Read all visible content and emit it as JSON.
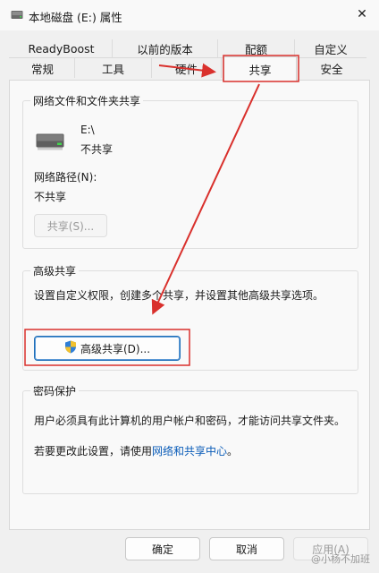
{
  "window": {
    "title": "本地磁盘 (E:) 属性",
    "close_glyph": "✕"
  },
  "tabs": {
    "row1": [
      "ReadyBoost",
      "以前的版本",
      "配额",
      "自定义"
    ],
    "row2": [
      "常规",
      "工具",
      "硬件",
      "共享",
      "安全"
    ],
    "active": "共享"
  },
  "network_sharing": {
    "group_title": "网络文件和文件夹共享",
    "drive_name": "E:\\",
    "drive_status": "不共享",
    "path_label": "网络路径(N):",
    "path_value": "不共享",
    "share_button": "共享(S)..."
  },
  "advanced_sharing": {
    "group_title": "高级共享",
    "description": "设置自定义权限，创建多个共享，并设置其他高级共享选项。",
    "button": "高级共享(D)..."
  },
  "password_protection": {
    "group_title": "密码保护",
    "description": "用户必须具有此计算机的用户帐户和密码，才能访问共享文件夹。",
    "change_prefix": "若要更改此设置，请使用",
    "change_link": "网络和共享中心",
    "change_suffix": "。"
  },
  "footer": {
    "ok": "确定",
    "cancel": "取消",
    "apply": "应用(A)"
  },
  "watermark": "@小杨不加班",
  "colors": {
    "annotation_red": "#d9302c",
    "link_blue": "#0a5cb8"
  },
  "icons": {
    "drive": "drive-icon",
    "shield": "uac-shield-icon",
    "close": "close-icon"
  }
}
